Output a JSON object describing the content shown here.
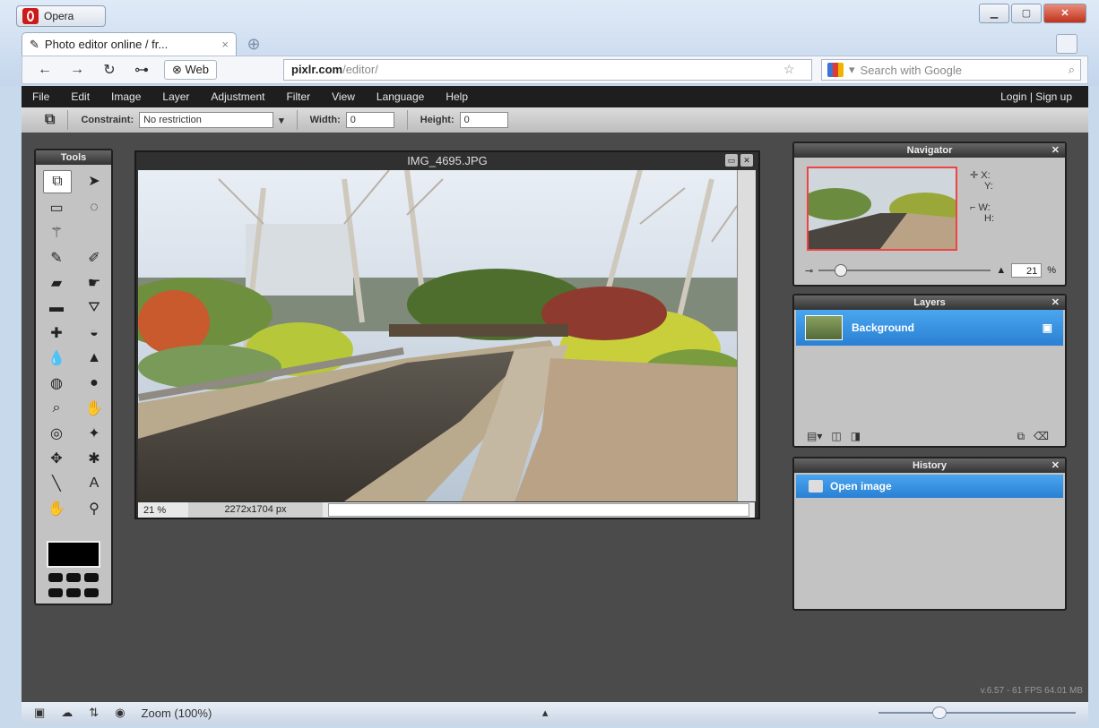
{
  "browser": {
    "app_button_label": "Opera",
    "tab_title": "Photo editor online / fr...",
    "tab_close": "×",
    "nav": {
      "back": "←",
      "forward": "→",
      "reload": "↻",
      "key": "⊶"
    },
    "web_badge": "Web",
    "address_host": "pixlr.com",
    "address_path": "/editor/",
    "search_placeholder": "Search with Google",
    "status_zoom": "Zoom (100%)"
  },
  "app": {
    "menu": [
      "File",
      "Edit",
      "Image",
      "Layer",
      "Adjustment",
      "Filter",
      "View",
      "Language",
      "Help"
    ],
    "login": "Login",
    "divider": "|",
    "signup": "Sign up",
    "options": {
      "constraint_label": "Constraint:",
      "constraint_value": "No restriction",
      "width_label": "Width:",
      "width_value": "0",
      "height_label": "Height:",
      "height_value": "0"
    },
    "tools_title": "Tools",
    "tools": [
      "crop-icon",
      "move-icon",
      "marquee-icon",
      "lasso-icon",
      "wand-icon",
      "",
      "pencil-icon",
      "brush-icon",
      "eraser-icon",
      "smudge-icon",
      "gradient-icon",
      "stamp-icon",
      "heal-icon",
      "bucket-icon",
      "drop-icon",
      "sharpen-icon",
      "sponge-icon",
      "dodge-icon",
      "zoom-tool-icon",
      "burn-icon",
      "redeye-icon",
      "spot-icon",
      "bloat-icon",
      "pinch-icon",
      "line-icon",
      "type-icon",
      "hand-icon",
      "magnify-icon"
    ],
    "image_window": {
      "title": "IMG_4695.JPG",
      "zoom": "21",
      "zoom_unit": "%",
      "dimensions": "2272x1704 px"
    },
    "navigator": {
      "title": "Navigator",
      "x_label": "X:",
      "y_label": "Y:",
      "w_label": "W:",
      "h_label": "H:",
      "zoom_value": "21",
      "zoom_unit": "%"
    },
    "layers": {
      "title": "Layers",
      "items": [
        {
          "name": "Background"
        }
      ]
    },
    "history": {
      "title": "History",
      "items": [
        {
          "name": "Open image"
        }
      ]
    },
    "version": "v.6.57 - 61 FPS 64.01 MB"
  },
  "colors": {
    "accent": "#2a80d3",
    "app_bg": "#4b4b4b",
    "menubar": "#1e1e1e"
  }
}
